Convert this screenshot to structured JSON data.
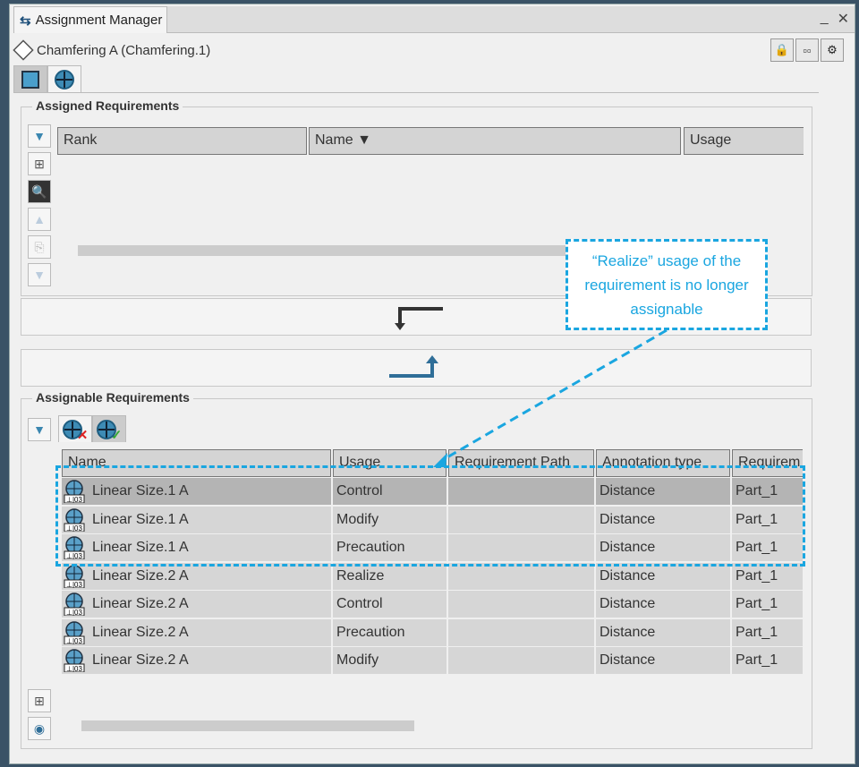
{
  "window": {
    "title": "Assignment Manager",
    "minimize": "_",
    "close": "✕"
  },
  "object": {
    "label": "Chamfering A (Chamfering.1)"
  },
  "assigned": {
    "title": "Assigned Requirements",
    "columns": [
      "Rank",
      "Name ▼",
      "Usage"
    ]
  },
  "assignable": {
    "title": "Assignable Requirements",
    "columns": [
      "Name",
      "Usage",
      "Requirement Path",
      "Annotation type",
      "Requirem"
    ],
    "rows": [
      {
        "name": "Linear Size.1 A",
        "usage": "Control",
        "path": "",
        "type": "Distance",
        "req": "Part_1"
      },
      {
        "name": "Linear Size.1 A",
        "usage": "Modify",
        "path": "",
        "type": "Distance",
        "req": "Part_1"
      },
      {
        "name": "Linear Size.1 A",
        "usage": "Precaution",
        "path": "",
        "type": "Distance",
        "req": "Part_1"
      },
      {
        "name": "Linear Size.2 A",
        "usage": "Realize",
        "path": "",
        "type": "Distance",
        "req": "Part_1"
      },
      {
        "name": "Linear Size.2 A",
        "usage": "Control",
        "path": "",
        "type": "Distance",
        "req": "Part_1"
      },
      {
        "name": "Linear Size.2 A",
        "usage": "Precaution",
        "path": "",
        "type": "Distance",
        "req": "Part_1"
      },
      {
        "name": "Linear Size.2 A",
        "usage": "Modify",
        "path": "",
        "type": "Distance",
        "req": "Part_1"
      }
    ]
  },
  "callout": {
    "text": "“Realize” usage of the requirement is no longer assignable"
  },
  "colors": {
    "accent": "#1aa6e0"
  }
}
